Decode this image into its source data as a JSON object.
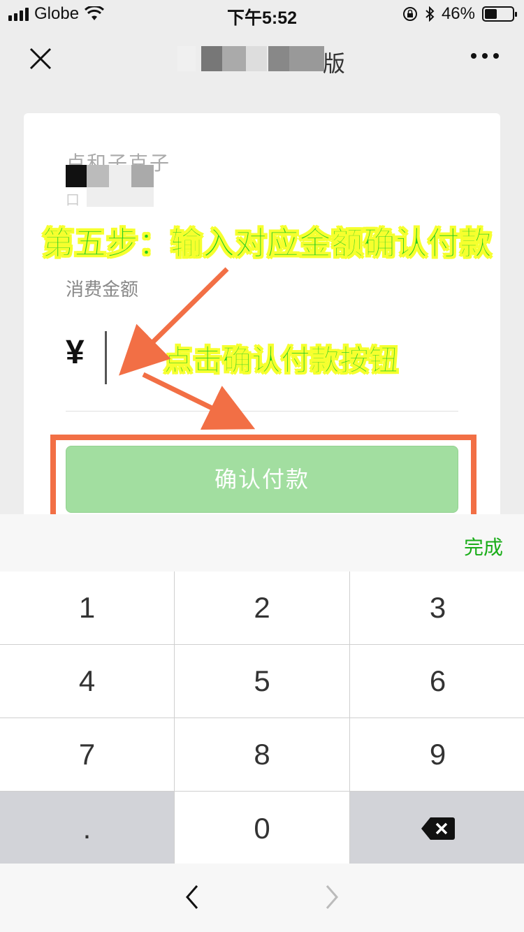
{
  "status_bar": {
    "carrier": "Globe",
    "time": "下午5:52",
    "battery": "46%",
    "battery_level": 0.46
  },
  "nav": {
    "title": "版",
    "close_icon": "close-icon",
    "more_icon": "more-icon"
  },
  "merchant": {
    "name_faint": "卢和子克子",
    "sub_faint": "口"
  },
  "form": {
    "amount_label": "消费金额",
    "currency_symbol": "¥",
    "amount_value": "",
    "confirm_button": "确认付款"
  },
  "annotations": {
    "step_text": "第五步：输入对应金额确认付款",
    "click_text": "点击确认付款按钮",
    "highlight_color": "#f26f45",
    "text_color": "#22cc22"
  },
  "keyboard": {
    "done_label": "完成",
    "keys": [
      "1",
      "2",
      "3",
      "4",
      "5",
      "6",
      "7",
      "8",
      "9",
      ".",
      "0"
    ],
    "delete_icon": "backspace-icon"
  },
  "toolbar": {
    "back_icon": "chevron-left-icon",
    "forward_icon": "chevron-right-icon"
  },
  "colors": {
    "accent_green": "#1aad19",
    "button_green_disabled": "#a2dea0"
  }
}
